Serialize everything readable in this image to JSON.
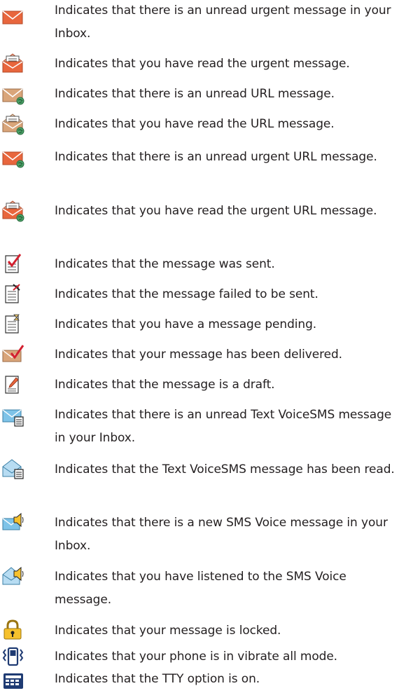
{
  "items": [
    {
      "icon": "envelope-urgent-unread-icon",
      "text": "Indicates that there is an unread urgent message in your Inbox."
    },
    {
      "icon": "envelope-urgent-read-icon",
      "text": "Indicates that you have read the urgent message."
    },
    {
      "icon": "envelope-url-unread-icon",
      "text": "Indicates that there is an unread URL message."
    },
    {
      "icon": "envelope-url-read-icon",
      "text": "Indicates that you have read the URL message."
    },
    {
      "icon": "envelope-urgent-url-unread-icon",
      "text": "Indicates that there is an unread urgent URL message."
    },
    {
      "icon": "envelope-urgent-url-read-icon",
      "text": "Indicates that you have read the urgent URL message."
    },
    {
      "icon": "message-sent-icon",
      "text": "Indicates that the message was sent."
    },
    {
      "icon": "message-failed-icon",
      "text": "Indicates that the message failed to be sent."
    },
    {
      "icon": "message-pending-icon",
      "text": "Indicates that you have a message pending."
    },
    {
      "icon": "message-delivered-icon",
      "text": "Indicates that your message has been delivered."
    },
    {
      "icon": "message-draft-icon",
      "text": "Indicates that the message is a draft."
    },
    {
      "icon": "text-voicesms-unread-icon",
      "text": "Indicates that there is an unread Text VoiceSMS message in your Inbox."
    },
    {
      "icon": "text-voicesms-read-icon",
      "text": "Indicates that the Text VoiceSMS message has been read."
    },
    {
      "icon": "sms-voice-new-icon",
      "text": "Indicates that there is a new SMS Voice message in your Inbox."
    },
    {
      "icon": "sms-voice-listened-icon",
      "text": "Indicates that you have listened to the SMS Voice message."
    },
    {
      "icon": "lock-icon",
      "text": "Indicates that your message is locked."
    },
    {
      "icon": "vibrate-icon",
      "text": "Indicates that your phone is in vibrate all mode."
    },
    {
      "icon": "tty-icon",
      "text": "Indicates that the TTY option is on."
    }
  ],
  "colors": {
    "text": "#231f20",
    "urgent_envelope": "#e8663d",
    "url_envelope": "#d9a57a",
    "globe": "#4aa368",
    "voicesms_envelope": "#7ec3e8",
    "lock_body": "#f6c12d",
    "check_red": "#d3202f"
  }
}
